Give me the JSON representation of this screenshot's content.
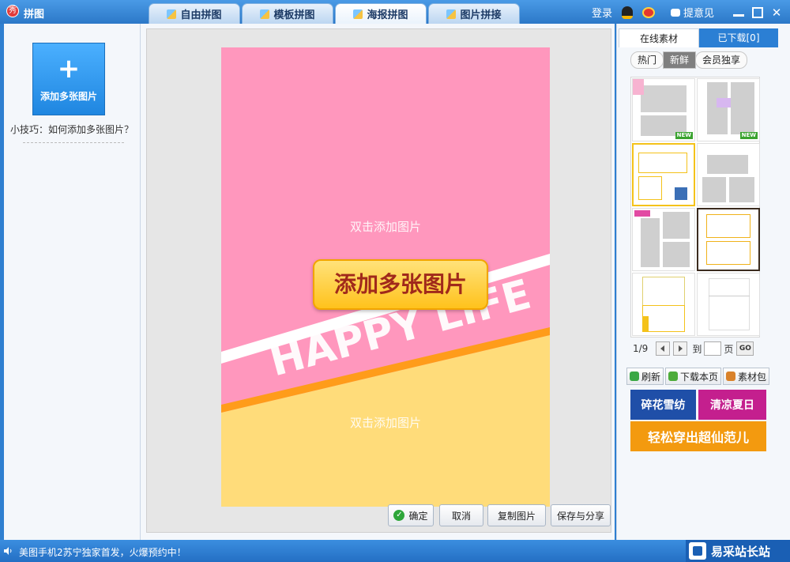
{
  "app": {
    "logo_text": "秀",
    "title": "拼图"
  },
  "tabs": [
    {
      "label": "自由拼图",
      "active": false
    },
    {
      "label": "模板拼图",
      "active": false
    },
    {
      "label": "海报拼图",
      "active": true
    },
    {
      "label": "图片拼接",
      "active": false
    }
  ],
  "topbar": {
    "login": "登录",
    "feedback": "提意见"
  },
  "left": {
    "add_button": "添加多张图片",
    "tip": "小技巧：如何添加多张图片？"
  },
  "poster": {
    "slot_top_text": "双击添加图片",
    "slot_bottom_text": "双击添加图片",
    "center_button": "添加多张图片",
    "banner_text": "HAPPY LIFE",
    "colors": {
      "top": "#ff97bd",
      "bottom": "#ffdc7a",
      "stripe": "#ff9c1a"
    }
  },
  "bottom_buttons": {
    "confirm": "确定",
    "cancel": "取消",
    "copy": "复制图片",
    "save_share": "保存与分享"
  },
  "right": {
    "tabs": [
      "在线素材",
      "已下载[0]"
    ],
    "filters": [
      "热门",
      "新鲜",
      "会员独享"
    ],
    "selected_filter": "新鲜",
    "thumbnails": [
      {
        "name": "template-1",
        "badge": "NEW"
      },
      {
        "name": "template-2",
        "badge": "NEW"
      },
      {
        "name": "template-3",
        "badge": ""
      },
      {
        "name": "template-4",
        "badge": ""
      },
      {
        "name": "template-5",
        "badge": ""
      },
      {
        "name": "template-6",
        "badge": ""
      },
      {
        "name": "template-7",
        "badge": ""
      },
      {
        "name": "template-8",
        "badge": ""
      }
    ],
    "pager": {
      "current": "1/9",
      "to": "到",
      "page": "页",
      "go": "GO"
    },
    "actions": [
      "刷新",
      "下载本页",
      "素材包"
    ],
    "promos": [
      {
        "text": "碎花雪纺",
        "color": "#1f4fa8"
      },
      {
        "text": "清凉夏日",
        "color": "#c41f8e"
      },
      {
        "text": "轻松穿出超仙范儿",
        "color": "#f39a0f"
      }
    ]
  },
  "statusbar": {
    "text": "美图手机2苏宁独家首发，火爆预约中！",
    "brand": "易采站长站"
  }
}
